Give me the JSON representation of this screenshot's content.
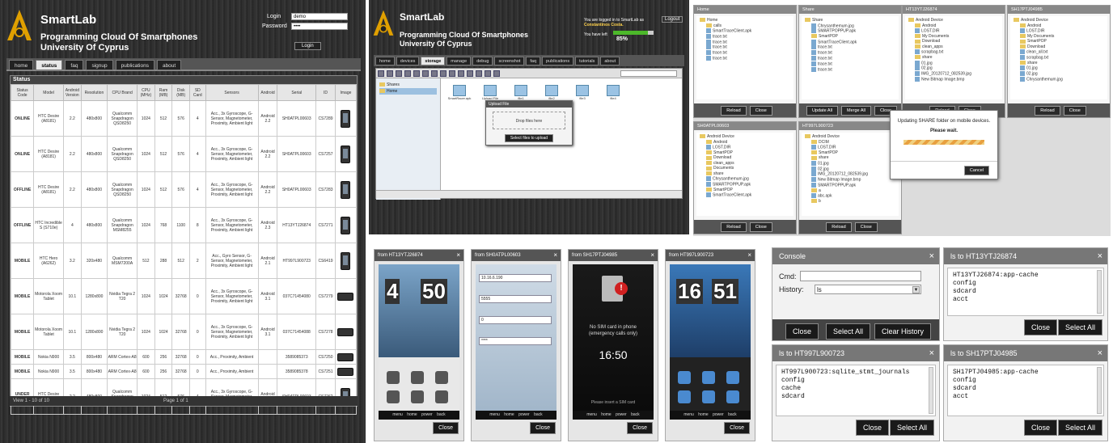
{
  "p1": {
    "title": "SmartLab",
    "subtitle_line1": "Programming Cloud Of Smartphones",
    "subtitle_line2": "University Of Cyprus",
    "login_label": "Login",
    "login_value": "demo",
    "password_label": "Password",
    "password_value": "••••",
    "login_button": "Login",
    "nav": [
      "home",
      "status",
      "faq",
      "signup",
      "publications",
      "about"
    ],
    "grid_caption": "Status",
    "columns": [
      "Status Code",
      "Model",
      "Android Version",
      "Resolution",
      "CPU Brand",
      "CPU (MHz)",
      "Ram (MB)",
      "Disk (MB)",
      "SD Card",
      "Sensors",
      "Android",
      "Serial",
      "ID",
      "Image"
    ],
    "rows": [
      {
        "status": "ONLINE",
        "cls": "st-online",
        "model": "HTC Desire (A8181)",
        "ver": "2.2",
        "res": "480x800",
        "cpu": "Qualcomm Snapdragon QSD8250",
        "mhz": "1024",
        "ram": "512",
        "disk": "576",
        "sd": "4",
        "sensors": "Acc., 3x Gyroscope, G-Sensor, Magnetometer, Proximity, Ambient light",
        "andr": "Android 2.2",
        "serial": "SH0ATPL00603",
        "id": "CS7289"
      },
      {
        "status": "ONLINE",
        "cls": "st-online",
        "model": "HTC Desire (A8181)",
        "ver": "2.2",
        "res": "480x800",
        "cpu": "Qualcomm Snapdragon QSD8250",
        "mhz": "1024",
        "ram": "512",
        "disk": "576",
        "sd": "4",
        "sensors": "Acc., 3x Gyroscope, G-Sensor, Magnetometer, Proximity, Ambient light",
        "andr": "Android 2.2",
        "serial": "SH0ATPL00603",
        "id": "CS7257"
      },
      {
        "status": "OFFLINE",
        "cls": "st-offline",
        "model": "HTC Desire (A8181)",
        "ver": "2.2",
        "res": "480x800",
        "cpu": "Qualcomm Snapdragon QSD8250",
        "mhz": "1024",
        "ram": "512",
        "disk": "576",
        "sd": "4",
        "sensors": "Acc., 3x Gyroscope, G-Sensor, Magnetometer, Proximity, Ambient light",
        "andr": "Android 2.2",
        "serial": "SH0ATPL00603",
        "id": "CS7283"
      },
      {
        "status": "OFFLINE",
        "cls": "st-offline",
        "model": "HTC Incredible S (S710e)",
        "ver": "4",
        "res": "480x800",
        "cpu": "Qualcomm Snapdragon MSM8255",
        "mhz": "1024",
        "ram": "768",
        "disk": "1100",
        "sd": "8",
        "sensors": "Acc., 3x Gyroscope, G-Sensor, Magnetometer, Proximity, Ambient light",
        "andr": "Android 2.3",
        "serial": "HT13YTJ26874",
        "id": "CS7271"
      },
      {
        "status": "MOBILE",
        "cls": "st-mobile",
        "model": "HTC Hero (A6262)",
        "ver": "3.2",
        "res": "320x480",
        "cpu": "Qualcomm MSM7200A",
        "mhz": "512",
        "ram": "288",
        "disk": "512",
        "sd": "2",
        "sensors": "Acc., Gyro Sensor, G-Sensor, Magnetometer, Proximity, Ambient light",
        "andr": "Android 2.1",
        "serial": "HT997L900723",
        "id": "CS6419"
      },
      {
        "status": "MOBILE",
        "cls": "st-mobile",
        "model": "Motorola Xoom Tablet",
        "ver": "10.1",
        "res": "1280x800",
        "cpu": "Nvidia Tegra 2 T20",
        "mhz": "1024",
        "ram": "1024",
        "disk": "32768",
        "sd": "0",
        "sensors": "Acc., 3x Gyroscope, G-Sensor, Magnetometer, Proximity, Ambient light",
        "andr": "Android 3.1",
        "serial": "037C71454080",
        "id": "CS7279"
      },
      {
        "status": "MOBILE",
        "cls": "st-mobile",
        "model": "Motorola Xoom Tablet",
        "ver": "10.1",
        "res": "1280x800",
        "cpu": "Nvidia Tegra 2 T20",
        "mhz": "1024",
        "ram": "1024",
        "disk": "32768",
        "sd": "0",
        "sensors": "Acc., 3x Gyroscope, G-Sensor, Magnetometer, Proximity, Ambient light",
        "andr": "Android 3.1",
        "serial": "037C71454088",
        "id": "CS7278"
      },
      {
        "status": "MOBILE",
        "cls": "st-mobile",
        "model": "Nokia N900",
        "ver": "3.5",
        "res": "800x480",
        "cpu": "ARM Cortex-A8",
        "mhz": "600",
        "ram": "256",
        "disk": "32768",
        "sd": "0",
        "sensors": "Acc., Proximity, Ambient",
        "andr": "",
        "serial": "3589085373",
        "id": "CS7250"
      },
      {
        "status": "MOBILE",
        "cls": "st-mobile",
        "model": "Nokia N900",
        "ver": "3.5",
        "res": "800x480",
        "cpu": "ARM Cortex-A8",
        "mhz": "600",
        "ram": "256",
        "disk": "32768",
        "sd": "0",
        "sensors": "Acc., Proximity, Ambient",
        "andr": "",
        "serial": "3589085378",
        "id": "CS7251"
      },
      {
        "status": "UNDER REPAIR",
        "cls": "st-under",
        "model": "HTC Desire (A8181)",
        "ver": "2.2",
        "res": "480x800",
        "cpu": "Qualcomm Snapdragon QSD8250",
        "mhz": "1024",
        "ram": "512",
        "disk": "576",
        "sd": "4",
        "sensors": "Acc., 3x Gyroscope, G-Sensor, Magnetometer, Proximity, Ambient light",
        "andr": "Android 2.2",
        "serial": "SH0ATPL00603",
        "id": "CS7262"
      }
    ],
    "footer": "View 1 - 10 of 10",
    "pager": "Page 1 of 1"
  },
  "p2": {
    "title": "SmartLab",
    "subtitle_line1": "Programming Cloud Of Smartphones",
    "subtitle_line2": "University Of Cyprus",
    "logged_text": "You are logged in to SmartLab as",
    "user": "Constantinos Costa.",
    "quota_label": "You have left",
    "quota_pct": "85%",
    "quota_fraction": 0.85,
    "logout": "Logout",
    "nav": [
      "home",
      "devices",
      "storage",
      "manage",
      "debug",
      "screenshot",
      "faq",
      "publications",
      "tutorials",
      "about"
    ],
    "active_nav": 2,
    "tree": [
      "Shares",
      "Home"
    ],
    "files": [
      "SmartRacer.apk",
      "Upload File",
      "file1",
      "file2",
      "file3",
      "file4"
    ],
    "dialog_title": "Upload File",
    "drop_text": "Drop files here",
    "dialog_button": "Select files to upload"
  },
  "p3": {
    "wins": [
      {
        "title": "Home",
        "items": [
          "Home",
          "calls",
          "SmartTraceClient.apk",
          "trace.txt",
          "trace.txt",
          "trace.txt",
          "trace.txt",
          "trace.txt"
        ],
        "buttons": [
          "Reload",
          "Close"
        ]
      },
      {
        "title": "Share",
        "items": [
          "Share",
          "Chrysanthemum.jpg",
          "SMARTPOPPUP.apk",
          "SmartPOP",
          "SmartTraceClient.apk",
          "trace.txt",
          "trace.txt",
          "trace.txt",
          "trace.txt",
          "trace.txt"
        ],
        "buttons": [
          "Update All",
          "Merge All",
          "Close"
        ]
      },
      {
        "title": "HT13YTJ26874",
        "items": [
          "Android Device",
          "Android",
          "LOST.DIR",
          "My Documents",
          "Download",
          "clean_apps",
          "scrapbag.txt",
          "share",
          "01.jpg",
          "02.jpg",
          "IMG_20120712_082539.jpg",
          "New Bitmap Image.bmp"
        ],
        "buttons": [
          "Reload",
          "Close"
        ]
      },
      {
        "title": "SH17PTJ04985",
        "items": [
          "Android Device",
          "Android",
          "LOST.DIR",
          "My Documents",
          "SmartPOP",
          "Download",
          "clean_all.txt",
          "scrapbag.txt",
          "share",
          "01.jpg",
          "02.jpg",
          "Chrysanthemum.jpg"
        ],
        "buttons": [
          "Reload",
          "Close"
        ]
      },
      {
        "title": "SH0ATPL00603",
        "items": [
          "Android Device",
          "Android",
          "LOST.DIR",
          "SmartPOP",
          "Download",
          "clean_apps",
          "Documents",
          "share",
          "Chrysanthemum.jpg",
          "SMARTPOPPUP.apk",
          "SmartPOP",
          "SmartTraceClient.apk"
        ],
        "buttons": [
          "Reload",
          "Close"
        ]
      },
      {
        "title": "HT997L900723",
        "items": [
          "Android Device",
          "DCIM",
          "LOST.DIR",
          "SmartPOP",
          "share",
          "01.jpg",
          "02.jpg",
          "IMG_20120712_082539.jpg",
          "New Bitmap Image.bmp",
          "SMARTPOPPUP.apk",
          "a",
          "abc.apk",
          "b"
        ],
        "buttons": [
          "Reload",
          "Close"
        ]
      }
    ],
    "dlg_line1": "Updating SHARE folder on mobile devices.",
    "dlg_line2": "Please wait.",
    "dlg_button": "Cancel"
  },
  "p4": {
    "screens": [
      {
        "title": "from HT13YTJ26874",
        "hour": "4",
        "min": "50",
        "kind": "home"
      },
      {
        "title": "from SH0ATPL00603",
        "hour": "",
        "min": "",
        "kind": "form"
      },
      {
        "title": "from SH17PTJ04985",
        "hour": "16",
        "min": "50",
        "kind": "lock"
      },
      {
        "title": "from HT997L900723",
        "hour": "16",
        "min": "51",
        "kind": "home2"
      }
    ],
    "nav_keys": "menu home power back",
    "close": "Close",
    "form_values": [
      "10.16.6.190",
      "5555",
      "0",
      "****"
    ],
    "sim_text_1": "No SIM card in phone",
    "sim_text_2": "(emergency calls only)",
    "unlock_hint": "Please insert a SIM card",
    "phone_label": "Phone"
  },
  "p5": {
    "console_title": "Console",
    "cmd_label": "Cmd:",
    "history_label": "History:",
    "history_value": "ls",
    "console_buttons": [
      "Close",
      "Select All",
      "Clear History"
    ],
    "terms": [
      {
        "title": "ls to HT13YTJ26874",
        "lines": [
          "HT13YTJ26874:app-cache",
          "config",
          "sdcard",
          "acct"
        ]
      },
      {
        "title": "ls to HT997L900723",
        "lines": [
          "HT997L900723:sqlite_stmt_journals",
          "config",
          "cache",
          "sdcard"
        ]
      },
      {
        "title": "ls to SH17PTJ04985",
        "lines": [
          "SH17PTJ04985:app-cache",
          "config",
          "sdcard",
          "acct"
        ]
      }
    ],
    "close": "Close",
    "select_all": "Select All"
  }
}
